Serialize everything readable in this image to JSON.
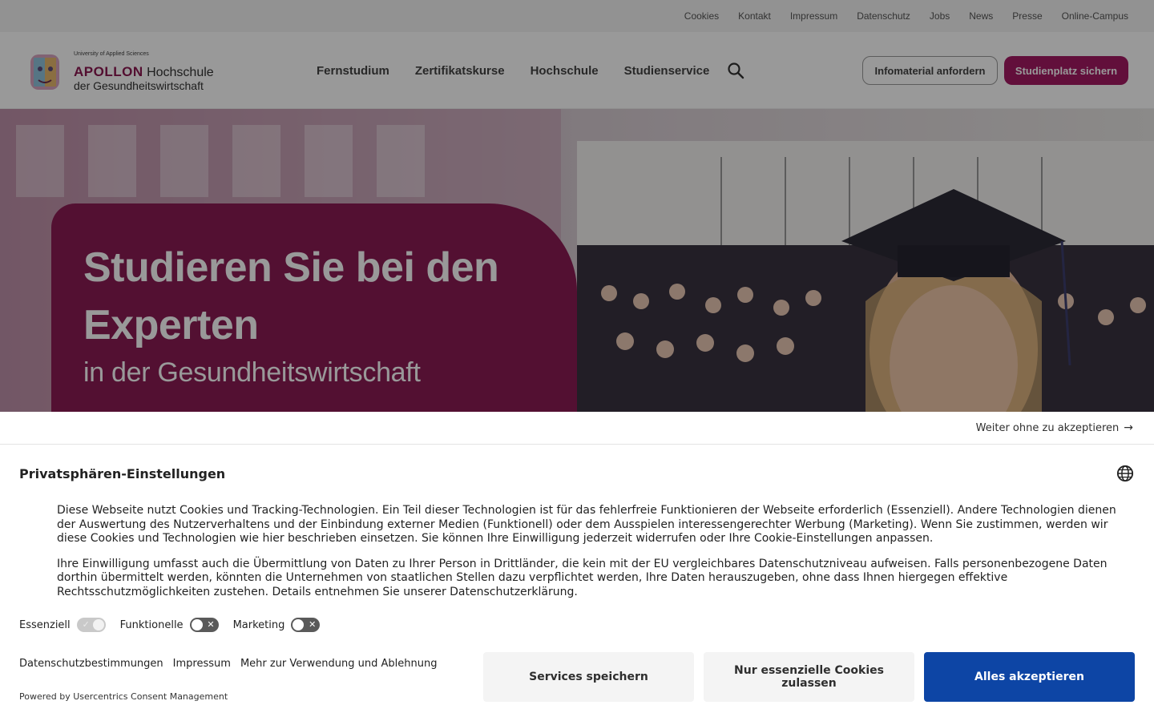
{
  "utility_nav": [
    "Cookies",
    "Kontakt",
    "Impressum",
    "Datenschutz",
    "Jobs",
    "News",
    "Presse",
    "Online-Campus"
  ],
  "logo": {
    "tagline": "University of Applied Sciences",
    "brand": "APOLLON",
    "brand_suffix": "Hochschule",
    "line2": "der Gesundheitswirtschaft"
  },
  "main_nav": [
    "Fernstudium",
    "Zertifikatskurse",
    "Hochschule",
    "Studienservice"
  ],
  "header_buttons": {
    "info": "Infomaterial anfordern",
    "apply": "Studienplatz sichern"
  },
  "hero": {
    "heading": "Studieren Sie bei den Experten",
    "subheading": "in der Gesundheitswirtschaft"
  },
  "consent": {
    "skip": "Weiter ohne zu akzeptieren",
    "title": "Privatsphären-Einstellungen",
    "paragraph1": "Diese Webseite nutzt Cookies und Tracking-Technologien. Ein Teil dieser Technologien ist für das fehlerfreie Funktionieren der Webseite erforderlich (Essenziell). Andere Technologien dienen der Auswertung des Nutzerverhaltens und der Einbindung externer Medien (Funktionell) oder dem Ausspielen interessengerechter Werbung (Marketing). Wenn Sie zustimmen, werden wir diese Cookies und Technologien wie hier beschrieben einsetzen. Sie können Ihre Einwilligung jederzeit widerrufen oder Ihre Cookie-Einstellungen anpassen.",
    "paragraph2": "Ihre Einwilligung umfasst auch die Übermittlung von Daten zu Ihrer Person in Drittländer, die kein mit der EU vergleichbares Datenschutzniveau aufweisen. Falls personenbezogene Daten dorthin übermittelt werden, könnten die Unternehmen von staatlichen Stellen dazu verpflichtet werden, Ihre Daten herauszugeben, ohne dass Ihnen hiergegen effektive Rechtsschutzmöglichkeiten zustehen. Details entnehmen Sie unserer Datenschutzerklärung.",
    "toggles": [
      {
        "label": "Essenziell",
        "state": "on-disabled"
      },
      {
        "label": "Funktionelle",
        "state": "off"
      },
      {
        "label": "Marketing",
        "state": "off"
      }
    ],
    "links": [
      "Datenschutzbestimmungen",
      "Impressum",
      "Mehr zur Verwendung und Ablehnung"
    ],
    "buttons": {
      "save": "Services speichern",
      "essential": "Nur essenzielle Cookies zulassen",
      "accept": "Alles akzeptieren"
    },
    "powered_by": "Powered by Usercentrics Consent Management"
  },
  "colors": {
    "brand": "#a31a63",
    "accept": "#0d45a5"
  }
}
